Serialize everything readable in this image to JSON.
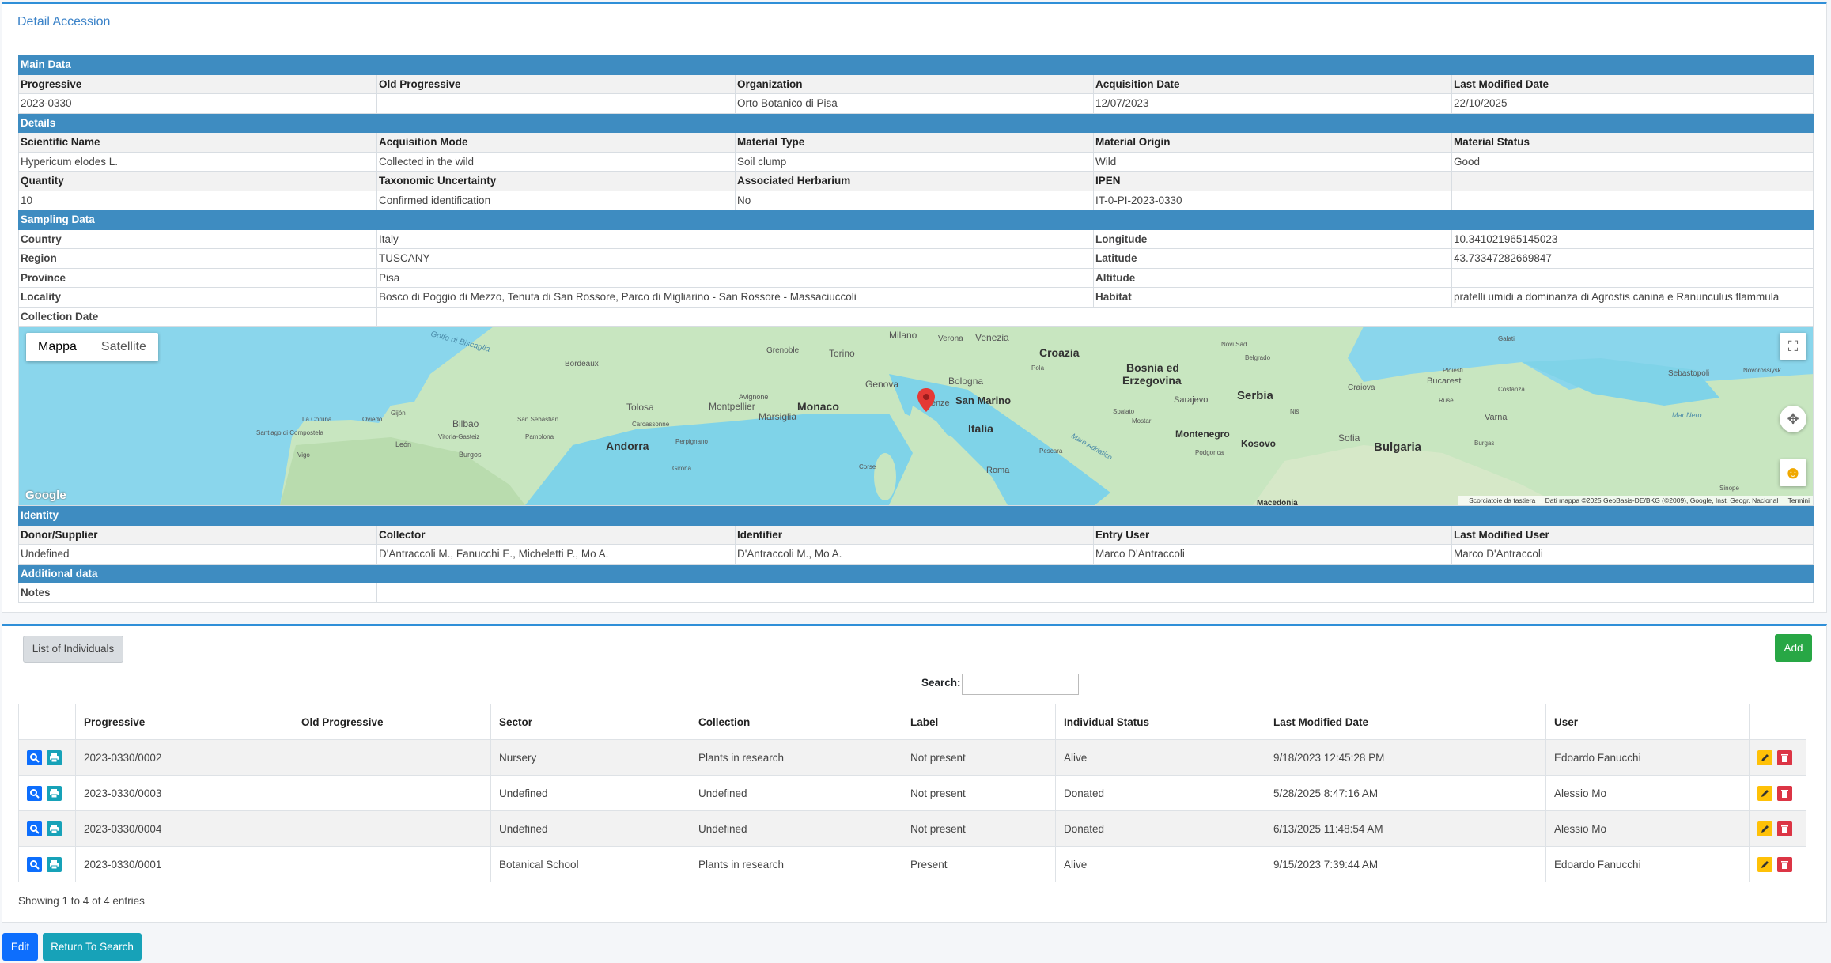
{
  "detail": {
    "title": "Detail Accession",
    "main": {
      "section": "Main Data",
      "labels": [
        "Progressive",
        "Old Progressive",
        "Organization",
        "Acquisition Date",
        "Last Modified Date"
      ],
      "values": [
        "2023-0330",
        "",
        "Orto Botanico di Pisa",
        "12/07/2023",
        "22/10/2025"
      ]
    },
    "details": {
      "section": "Details",
      "labels1": [
        "Scientific Name",
        "Acquisition Mode",
        "Material Type",
        "Material Origin",
        "Material Status"
      ],
      "values1": [
        "Hypericum elodes L.",
        "Collected in the wild",
        "Soil clump",
        "Wild",
        "Good"
      ],
      "labels2": [
        "Quantity",
        "Taxonomic Uncertainty",
        "Associated Herbarium",
        "IPEN",
        ""
      ],
      "values2": [
        "10",
        "Confirmed identification",
        "No",
        "IT-0-PI-2023-0330",
        ""
      ]
    },
    "sampling": {
      "section": "Sampling Data",
      "country_label": "Country",
      "country": "Italy",
      "longitude_label": "Longitude",
      "longitude": "10.341021965145023",
      "region_label": "Region",
      "region": "TUSCANY",
      "latitude_label": "Latitude",
      "latitude": "43.73347282669847",
      "province_label": "Province",
      "province": "Pisa",
      "altitude_label": "Altitude",
      "altitude": "",
      "locality_label": "Locality",
      "locality": "Bosco di Poggio di Mezzo, Tenuta di San Rossore, Parco di Migliarino - San Rossore - Massaciuccoli",
      "habitat_label": "Habitat",
      "habitat": "pratelli umidi a dominanza di Agrostis canina e Ranunculus flammula",
      "collection_date_label": "Collection Date",
      "collection_date": ""
    },
    "map": {
      "type_map": "Mappa",
      "type_satellite": "Satellite",
      "google": "Google",
      "attribution": [
        "Scorciatoie da tastiera",
        "Dati mappa ©2025 GeoBasis-DE/BKG (©2009), Google, Inst. Geogr. Nacional",
        "Termini"
      ],
      "places": [
        "Golfo di Biscaglia",
        "Bordeaux",
        "Grenoble",
        "Torino",
        "Milano",
        "Verona",
        "Venezia",
        "Croazia",
        "Novi Sad",
        "Galati",
        "Sebastopoli",
        "Novorossiysk",
        "Genova",
        "Bologna",
        "Pola",
        "Bosnia ed",
        "Erzegovina",
        "Belgrado",
        "Craiova",
        "Ploiesti",
        "Bucarest",
        "Avignone",
        "Monaco",
        "Firenze",
        "San Marino",
        "Sarajevo",
        "Serbia",
        "Ruse",
        "Costanza",
        "Tolosa",
        "Montpellier",
        "Marsiglia",
        "Spalato",
        "Niš",
        "Varna",
        "Mar Nero",
        "La Coruña",
        "Oviedo",
        "Gijón",
        "Bilbao",
        "San Sebastián",
        "Carcassonne",
        "Italia",
        "Mostar",
        "Montenegro",
        "Kosovo",
        "Sofia",
        "Bulgaria",
        "Santiago di Compostela",
        "Vitoria-Gasteiz",
        "Pamplona",
        "Perpignano",
        "Mare Adriatico",
        "Podgorica",
        "Burgas",
        "León",
        "Andorra",
        "Burgos",
        "Vigo",
        "Corse",
        "Girona",
        "Pescara",
        "Roma",
        "Macedonia",
        "Sinope"
      ]
    },
    "identity": {
      "section": "Identity",
      "labels": [
        "Donor/Supplier",
        "Collector",
        "Identifier",
        "Entry User",
        "Last Modified User"
      ],
      "values": [
        "Undefined",
        "D'Antraccoli M., Fanucchi E., Micheletti P., Mo A.",
        "D'Antraccoli M., Mo A.",
        "Marco D'Antraccoli",
        "Marco D'Antraccoli"
      ]
    },
    "additional": {
      "section": "Additional data",
      "notes_label": "Notes",
      "notes": ""
    }
  },
  "individuals": {
    "tab_label": "List of Individuals",
    "add_label": "Add",
    "search_label": "Search:",
    "search_value": "",
    "columns": [
      "",
      "Progressive",
      "Old Progressive",
      "Sector",
      "Collection",
      "Label",
      "Individual Status",
      "Last Modified Date",
      "User",
      ""
    ],
    "rows": [
      {
        "progressive": "2023-0330/0002",
        "old": "",
        "sector": "Nursery",
        "collection": "Plants in research",
        "label": "Not present",
        "status": "Alive",
        "modified": "9/18/2023 12:45:28 PM",
        "user": "Edoardo Fanucchi"
      },
      {
        "progressive": "2023-0330/0003",
        "old": "",
        "sector": "Undefined",
        "collection": "Undefined",
        "label": "Not present",
        "status": "Donated",
        "modified": "5/28/2025 8:47:16 AM",
        "user": "Alessio Mo"
      },
      {
        "progressive": "2023-0330/0004",
        "old": "",
        "sector": "Undefined",
        "collection": "Undefined",
        "label": "Not present",
        "status": "Donated",
        "modified": "6/13/2025 11:48:54 AM",
        "user": "Alessio Mo"
      },
      {
        "progressive": "2023-0330/0001",
        "old": "",
        "sector": "Botanical School",
        "collection": "Plants in research",
        "label": "Present",
        "status": "Alive",
        "modified": "9/15/2023 7:39:44 AM",
        "user": "Edoardo Fanucchi"
      }
    ],
    "showing": "Showing 1 to 4 of 4 entries"
  },
  "footer": {
    "edit_label": "Edit",
    "return_label": "Return To Search"
  },
  "colors": {
    "section_header": "#3e8cc1",
    "card_accent": "#2f8fd8",
    "add_button": "#28a745",
    "edit_button": "#0d6efd",
    "return_button": "#17a2b8",
    "map_pin": "#e53935"
  }
}
